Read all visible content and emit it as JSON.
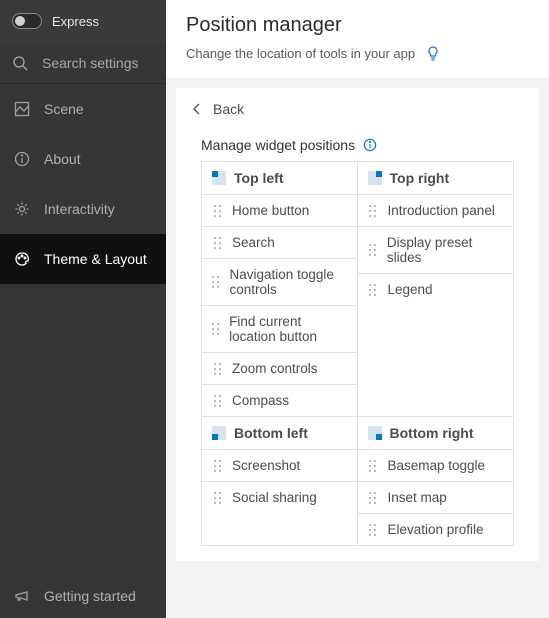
{
  "sidebar": {
    "express_label": "Express",
    "search_placeholder": "Search settings",
    "items": [
      {
        "label": "Scene"
      },
      {
        "label": "About"
      },
      {
        "label": "Interactivity"
      },
      {
        "label": "Theme & Layout"
      }
    ],
    "footer_label": "Getting started"
  },
  "header": {
    "title": "Position manager",
    "subtitle": "Change the location of tools in your app"
  },
  "panel": {
    "back_label": "Back",
    "section_title": "Manage widget positions"
  },
  "quads": {
    "top_left": {
      "title": "Top left",
      "items": [
        "Home button",
        "Search",
        "Navigation toggle controls",
        "Find current location button",
        "Zoom controls",
        "Compass"
      ]
    },
    "top_right": {
      "title": "Top right",
      "items": [
        "Introduction panel",
        "Display preset slides",
        "Legend"
      ]
    },
    "bottom_left": {
      "title": "Bottom left",
      "items": [
        "Screenshot",
        "Social sharing"
      ]
    },
    "bottom_right": {
      "title": "Bottom right",
      "items": [
        "Basemap toggle",
        "Inset map",
        "Elevation profile"
      ]
    }
  }
}
